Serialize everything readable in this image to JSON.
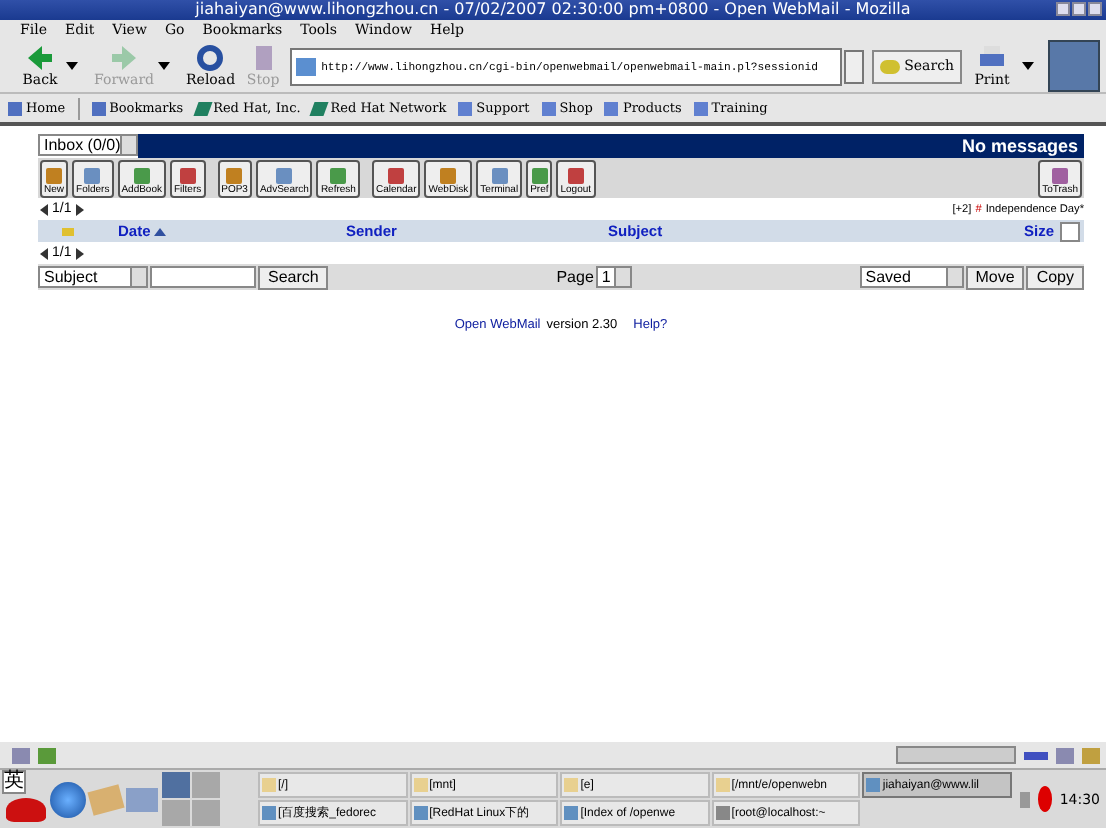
{
  "window": {
    "title": "jiahaiyan@www.lihongzhou.cn - 07/02/2007 02:30:00 pm+0800 - Open WebMail - Mozilla"
  },
  "menu": [
    "File",
    "Edit",
    "View",
    "Go",
    "Bookmarks",
    "Tools",
    "Window",
    "Help"
  ],
  "nav_buttons": [
    {
      "label": "Back",
      "disabled": false,
      "dropdown": true
    },
    {
      "label": "Forward",
      "disabled": true,
      "dropdown": true
    },
    {
      "label": "Reload",
      "disabled": false,
      "dropdown": false
    },
    {
      "label": "Stop",
      "disabled": true,
      "dropdown": false
    }
  ],
  "address": {
    "value": "http://www.lihongzhou.cn/cgi-bin/openwebmail/openwebmail-main.pl?sessionid"
  },
  "search_button": "Search",
  "print_button": "Print",
  "bookmarks": [
    {
      "label": "Home",
      "kind": "home"
    },
    {
      "label": "Bookmarks",
      "kind": "bookmarks"
    },
    {
      "label": "Red Hat, Inc.",
      "kind": "link"
    },
    {
      "label": "Red Hat Network",
      "kind": "link"
    },
    {
      "label": "Support",
      "kind": "folder"
    },
    {
      "label": "Shop",
      "kind": "folder"
    },
    {
      "label": "Products",
      "kind": "folder"
    },
    {
      "label": "Training",
      "kind": "folder"
    }
  ],
  "webmail": {
    "folder": "Inbox (0/0)",
    "status": "No messages",
    "tools": [
      "New",
      "Folders",
      "AddBook",
      "Filters",
      "POP3",
      "AdvSearch",
      "Refresh",
      "Calendar",
      "WebDisk",
      "Terminal",
      "Pref",
      "Logout"
    ],
    "trash_button": "ToTrash",
    "page_count": "1/1",
    "event_count": "[+2]",
    "event_mark": "#",
    "event": "Independence Day*",
    "columns": [
      {
        "label": "Date",
        "sorted": true
      },
      {
        "label": "Sender",
        "sorted": false
      },
      {
        "label": "Subject",
        "sorted": false
      },
      {
        "label": "Size",
        "sorted": false
      }
    ],
    "select_all": false,
    "page_count_bottom": "1/1",
    "search_field": "Subject",
    "search_button": "Search",
    "page_label": "Page",
    "page": "1",
    "move_target": "Saved",
    "move_button": "Move",
    "copy_button": "Copy",
    "footer_link": "Open WebMail",
    "footer_text": "version 2.30",
    "help_link": "Help?"
  },
  "progress": {
    "level": 0
  },
  "taskbar": {
    "ime": "英",
    "tasks": [
      {
        "label": "[/]",
        "selected": false,
        "kind": "folder"
      },
      {
        "label": "[mnt]",
        "selected": false,
        "kind": "folder"
      },
      {
        "label": "[e]",
        "selected": false,
        "kind": "folder"
      },
      {
        "label": "[/mnt/e/openwebn",
        "selected": false,
        "kind": "folder"
      },
      {
        "label": "jiahaiyan@www.lil",
        "selected": true,
        "kind": "browser"
      },
      {
        "label": "[百度搜索_fedorec",
        "selected": false,
        "kind": "browser"
      },
      {
        "label": "[RedHat Linux下的",
        "selected": false,
        "kind": "browser"
      },
      {
        "label": "[Index of /openwe",
        "selected": false,
        "kind": "browser"
      },
      {
        "label": "[root@localhost:~",
        "selected": false,
        "kind": "terminal"
      }
    ],
    "clock": "14:30"
  }
}
